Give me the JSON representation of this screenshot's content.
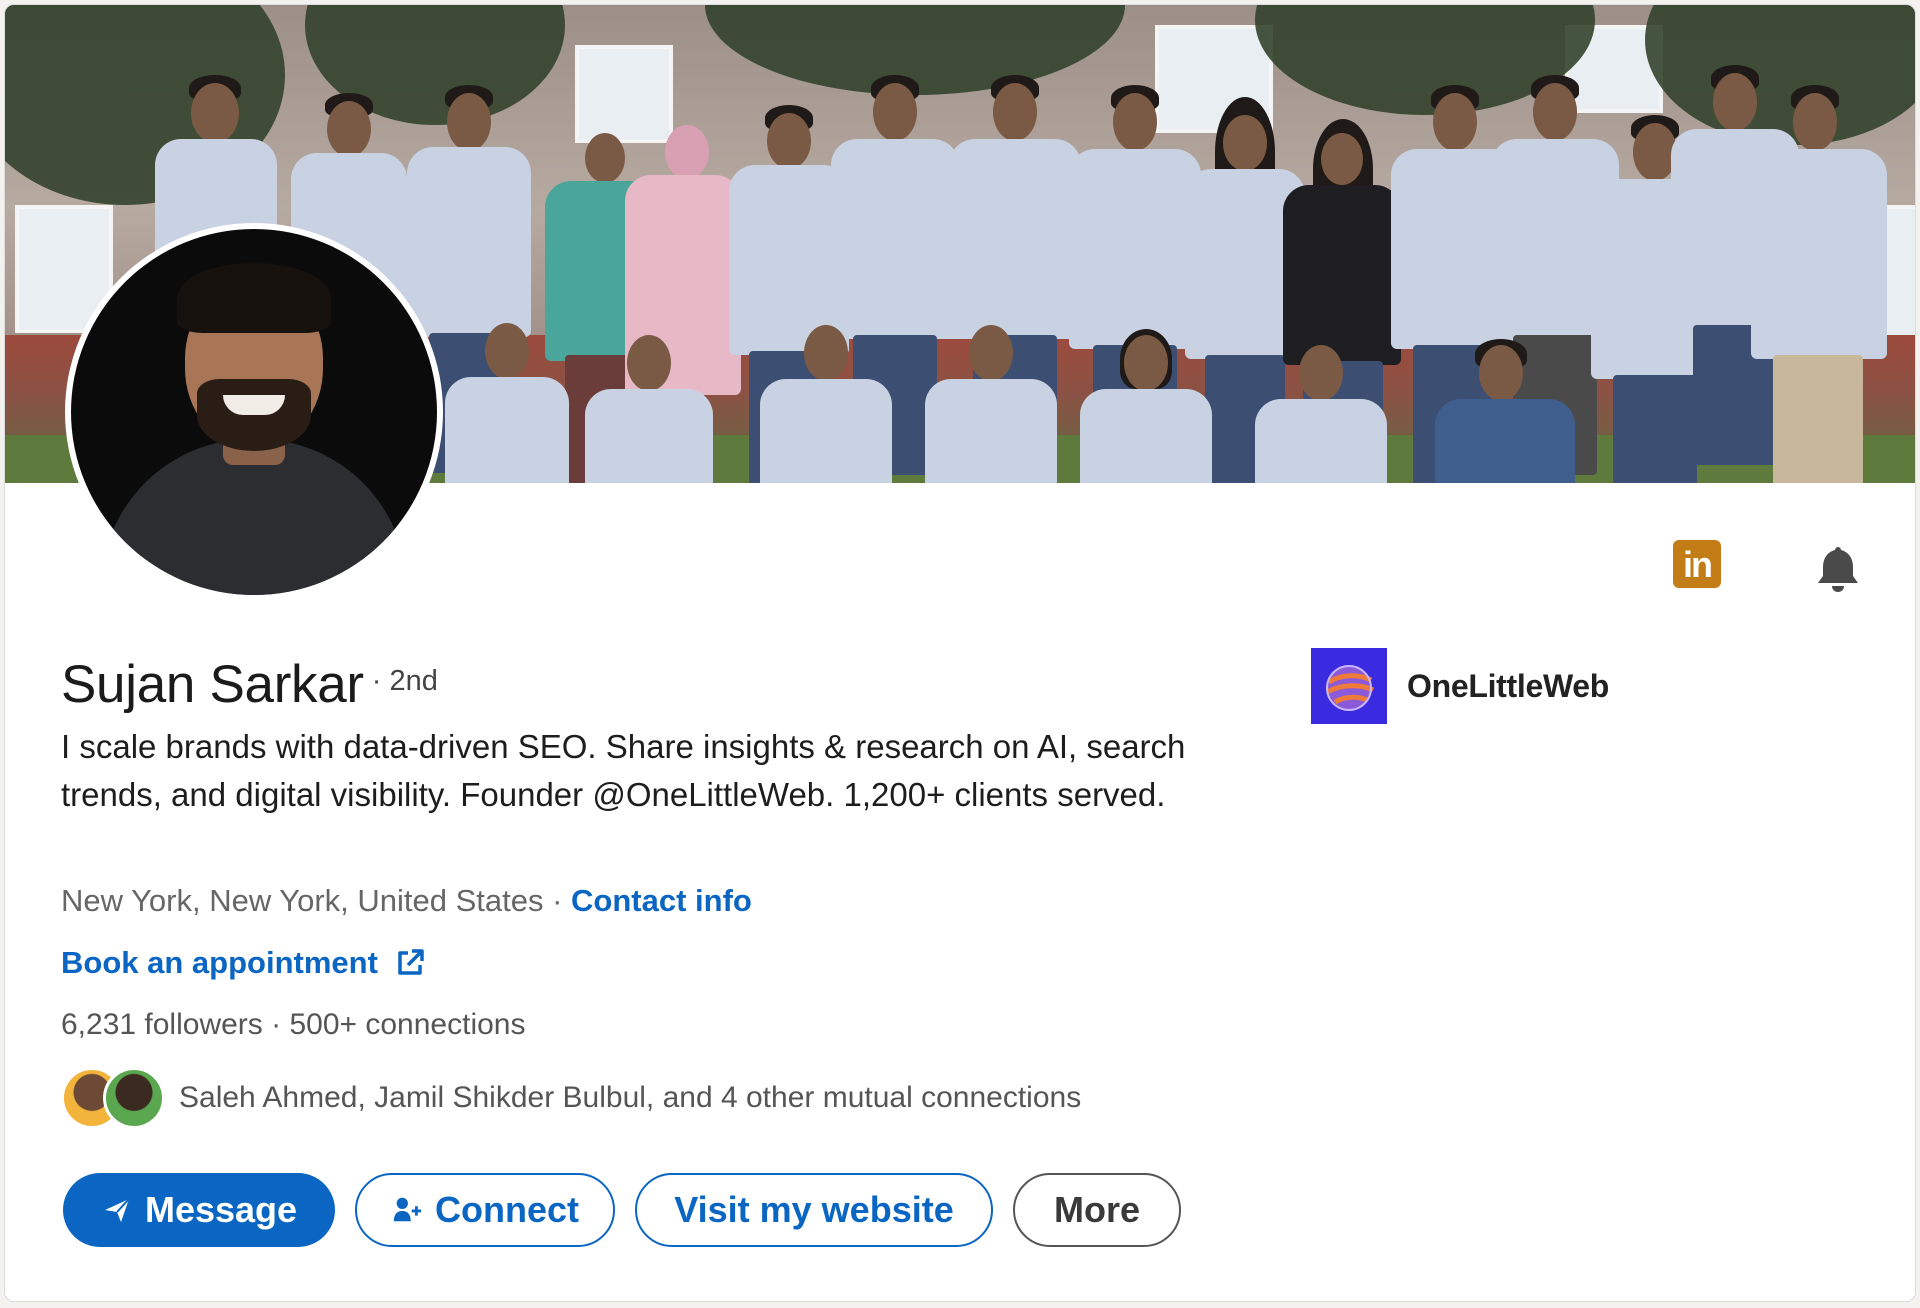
{
  "profile": {
    "name": "Sujan Sarkar",
    "degree": "· 2nd",
    "headline": "I scale brands with data-driven SEO. Share insights & research on AI, search trends, and digital visibility. Founder @OneLittleWeb. 1,200+ clients served.",
    "location": "New York, New York, United States",
    "separator": " · ",
    "contact_info_label": "Contact info",
    "appointment_label": "Book an appointment",
    "followers": "6,231 followers",
    "connections": " · 500+ connections",
    "mutual_connections": "Saleh Ahmed, Jamil Shikder Bulbul, and 4 other mutual connections"
  },
  "company": {
    "name": "OneLittleWeb"
  },
  "icons": {
    "linkedin_logo_text": "in",
    "linkedin_logo_color": "#c37d16",
    "bell": "bell-icon",
    "external_link": "external-link-icon"
  },
  "actions": {
    "message_label": "Message",
    "connect_label": "Connect",
    "visit_label": "Visit my website",
    "more_label": "More"
  },
  "colors": {
    "accent": "#0a66c2",
    "company_logo": "#3b2be0"
  }
}
